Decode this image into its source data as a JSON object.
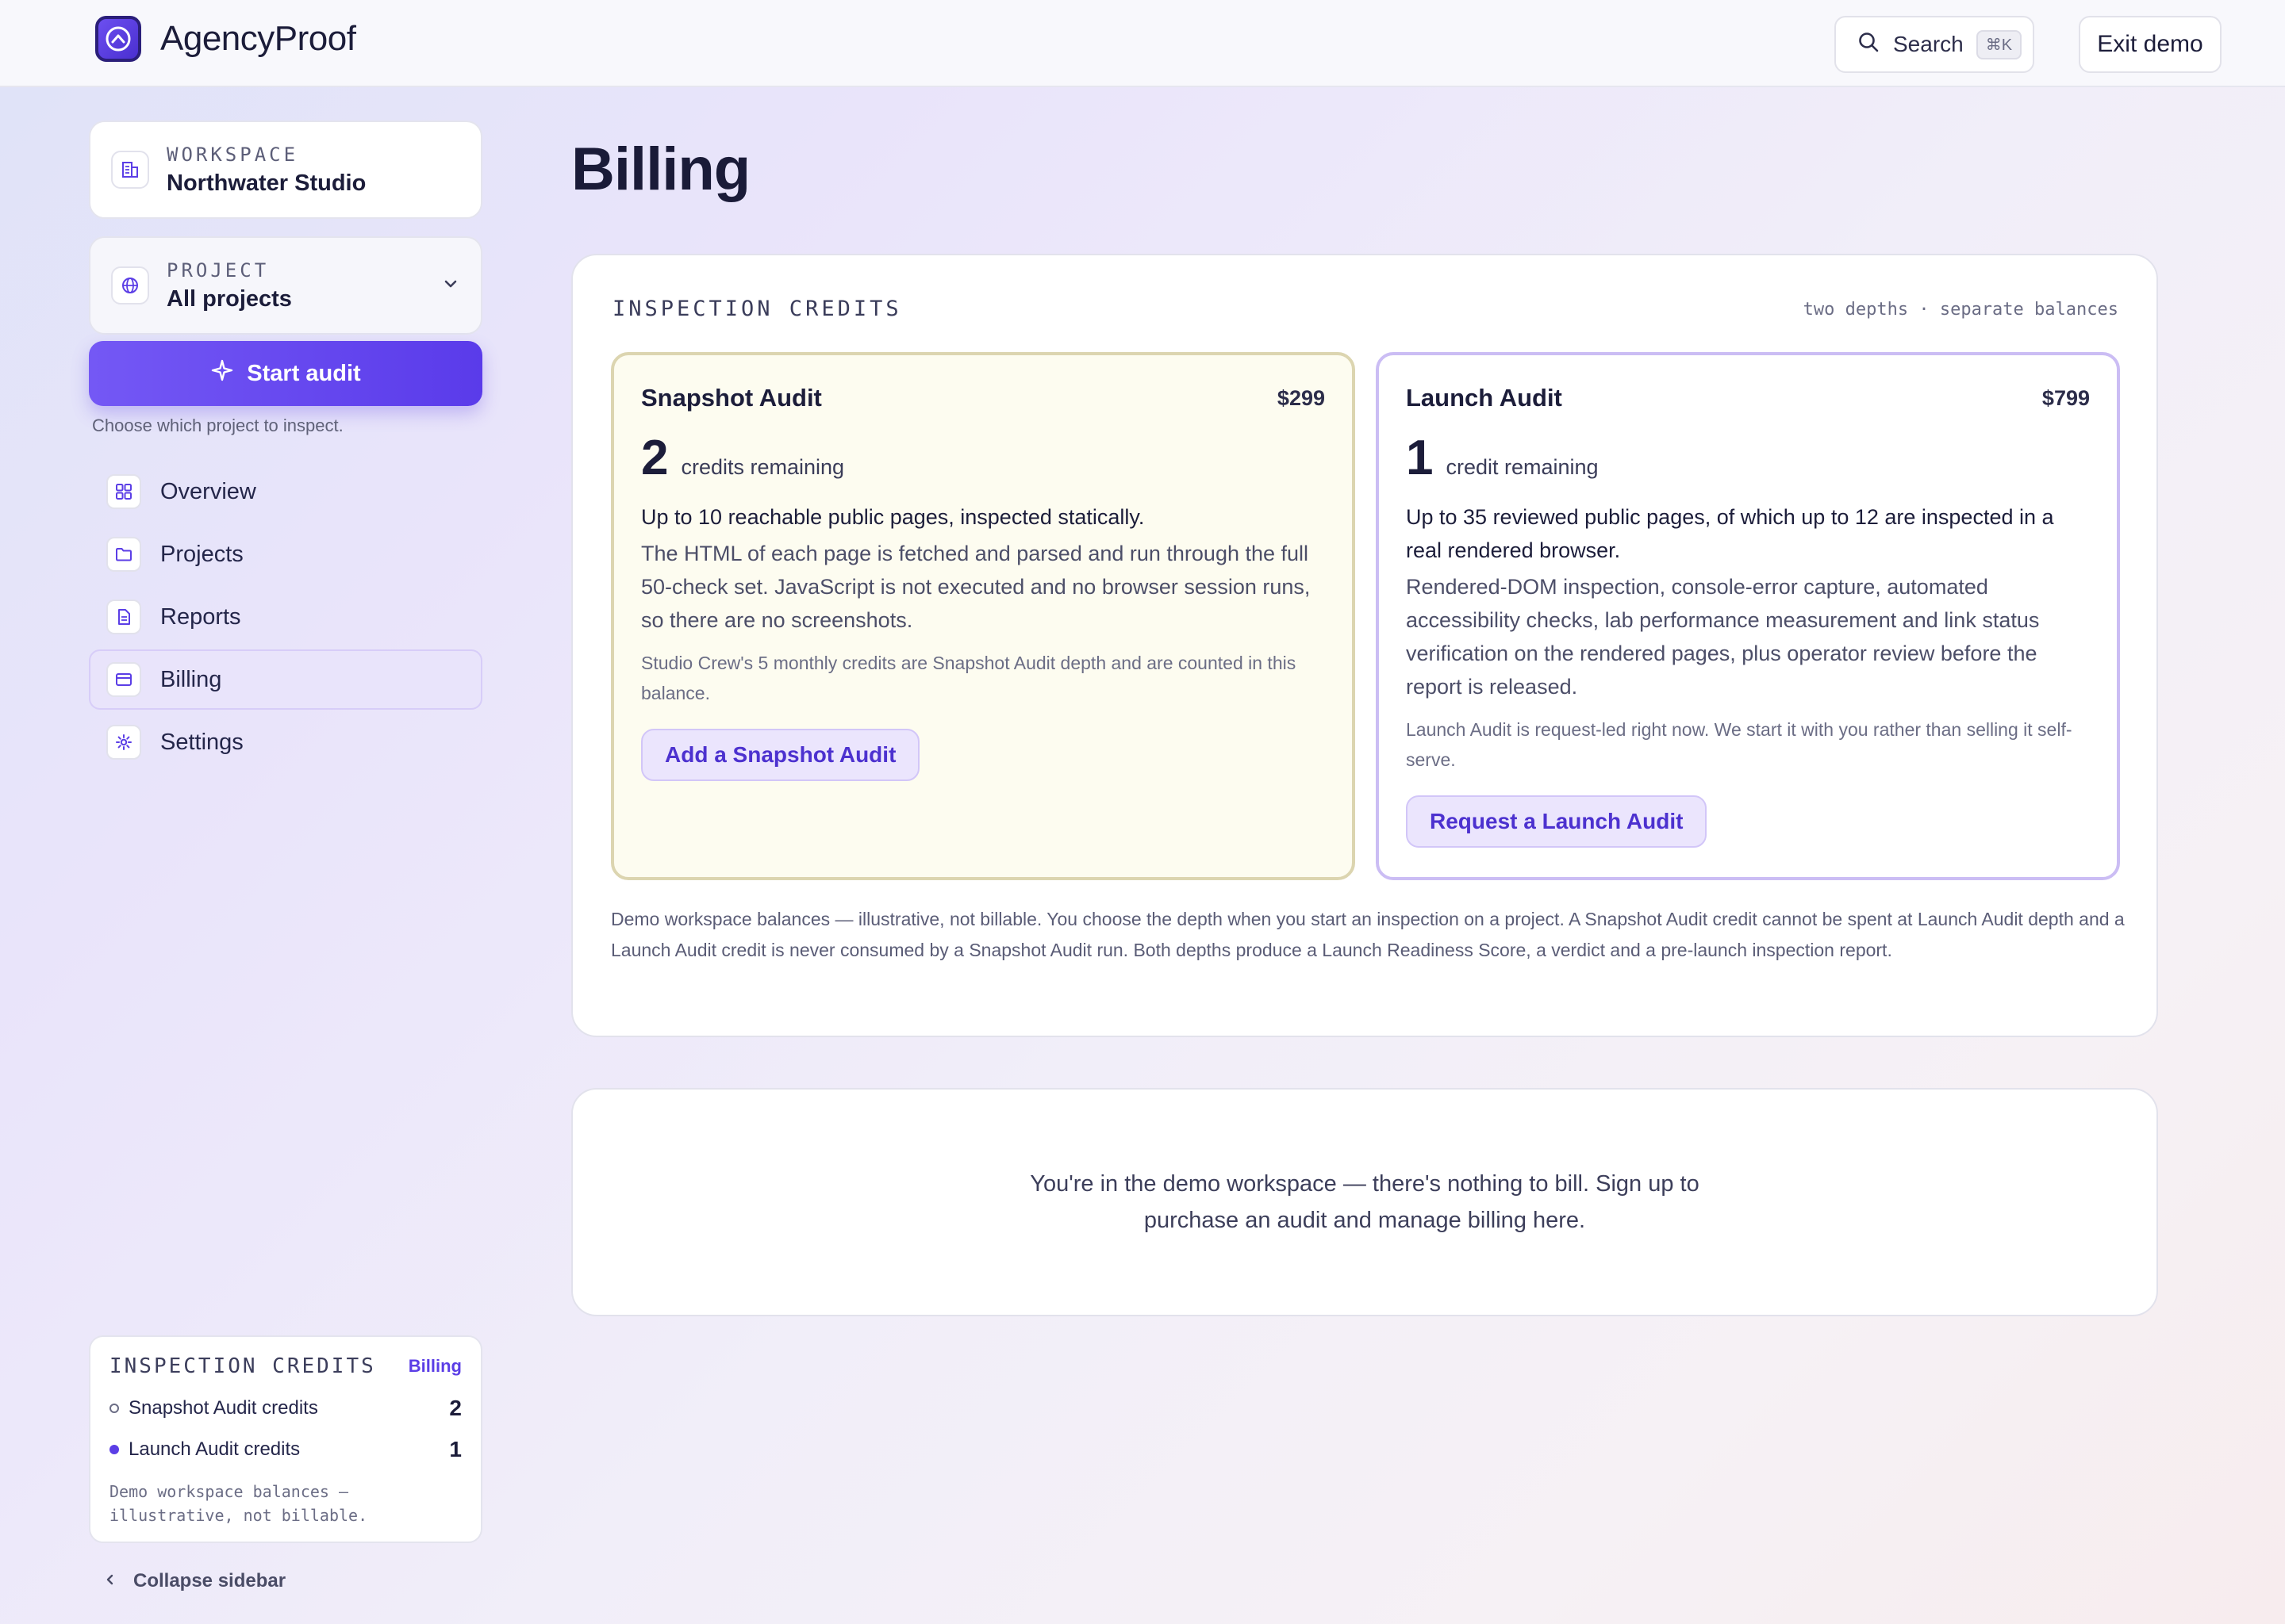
{
  "brand": {
    "name": "AgencyProof"
  },
  "topbar": {
    "search_label": "Search",
    "search_shortcut": "⌘K",
    "exit_label": "Exit demo"
  },
  "sidebar": {
    "workspace": {
      "label": "WORKSPACE",
      "value": "Northwater Studio"
    },
    "project": {
      "label": "PROJECT",
      "value": "All projects"
    },
    "start_button": "Start audit",
    "start_hint": "Choose which project to inspect.",
    "nav": [
      {
        "label": "Overview",
        "icon": "grid-icon",
        "active": false
      },
      {
        "label": "Projects",
        "icon": "folder-icon",
        "active": false
      },
      {
        "label": "Reports",
        "icon": "document-icon",
        "active": false
      },
      {
        "label": "Billing",
        "icon": "credit-card-icon",
        "active": true
      },
      {
        "label": "Settings",
        "icon": "gear-icon",
        "active": false
      }
    ],
    "credits": {
      "title": "INSPECTION CREDITS",
      "link": "Billing",
      "rows": [
        {
          "label": "Snapshot Audit credits",
          "value": "2"
        },
        {
          "label": "Launch Audit credits",
          "value": "1"
        }
      ],
      "note": "Demo workspace balances — illustrative, not billable."
    },
    "collapse_label": "Collapse sidebar"
  },
  "main": {
    "title": "Billing",
    "credits_panel": {
      "title": "INSPECTION CREDITS",
      "subtitle": "two depths · separate balances",
      "plans": [
        {
          "name": "Snapshot Audit",
          "price": "$299",
          "count": "2",
          "count_label": "credits remaining",
          "lead": "Up to 10 reachable public pages, inspected statically.",
          "description": "The HTML of each page is fetched and parsed and run through the full 50-check set. JavaScript is not executed and no browser session runs, so there are no screenshots.",
          "note": "Studio Crew's 5 monthly credits are Snapshot Audit depth and are counted in this balance.",
          "button": "Add a Snapshot Audit"
        },
        {
          "name": "Launch Audit",
          "price": "$799",
          "count": "1",
          "count_label": "credit remaining",
          "lead": "Up to 35 reviewed public pages, of which up to 12 are inspected in a real rendered browser.",
          "description": "Rendered-DOM inspection, console-error capture, automated accessibility checks, lab performance measurement and link status verification on the rendered pages, plus operator review before the report is released.",
          "note": "Launch Audit is request-led right now. We start it with you rather than selling it self-serve.",
          "button": "Request a Launch Audit"
        }
      ],
      "footnote": "Demo workspace balances — illustrative, not billable. You choose the depth when you start an inspection on a project. A Snapshot Audit credit cannot be spent at Launch Audit depth and a Launch Audit credit is never consumed by a Snapshot Audit run. Both depths produce a Launch Readiness Score, a verdict and a pre-launch inspection report."
    },
    "demo_notice": "You're in the demo workspace — there's nothing to bill. Sign up to purchase an audit and manage billing here."
  },
  "colors": {
    "accent": "#5b3ee6",
    "accent_light": "#ebe5fd",
    "snapshot_bg": "#fdfcf0",
    "snapshot_border": "#dcd5b0",
    "launch_border": "#cbbdf4"
  }
}
